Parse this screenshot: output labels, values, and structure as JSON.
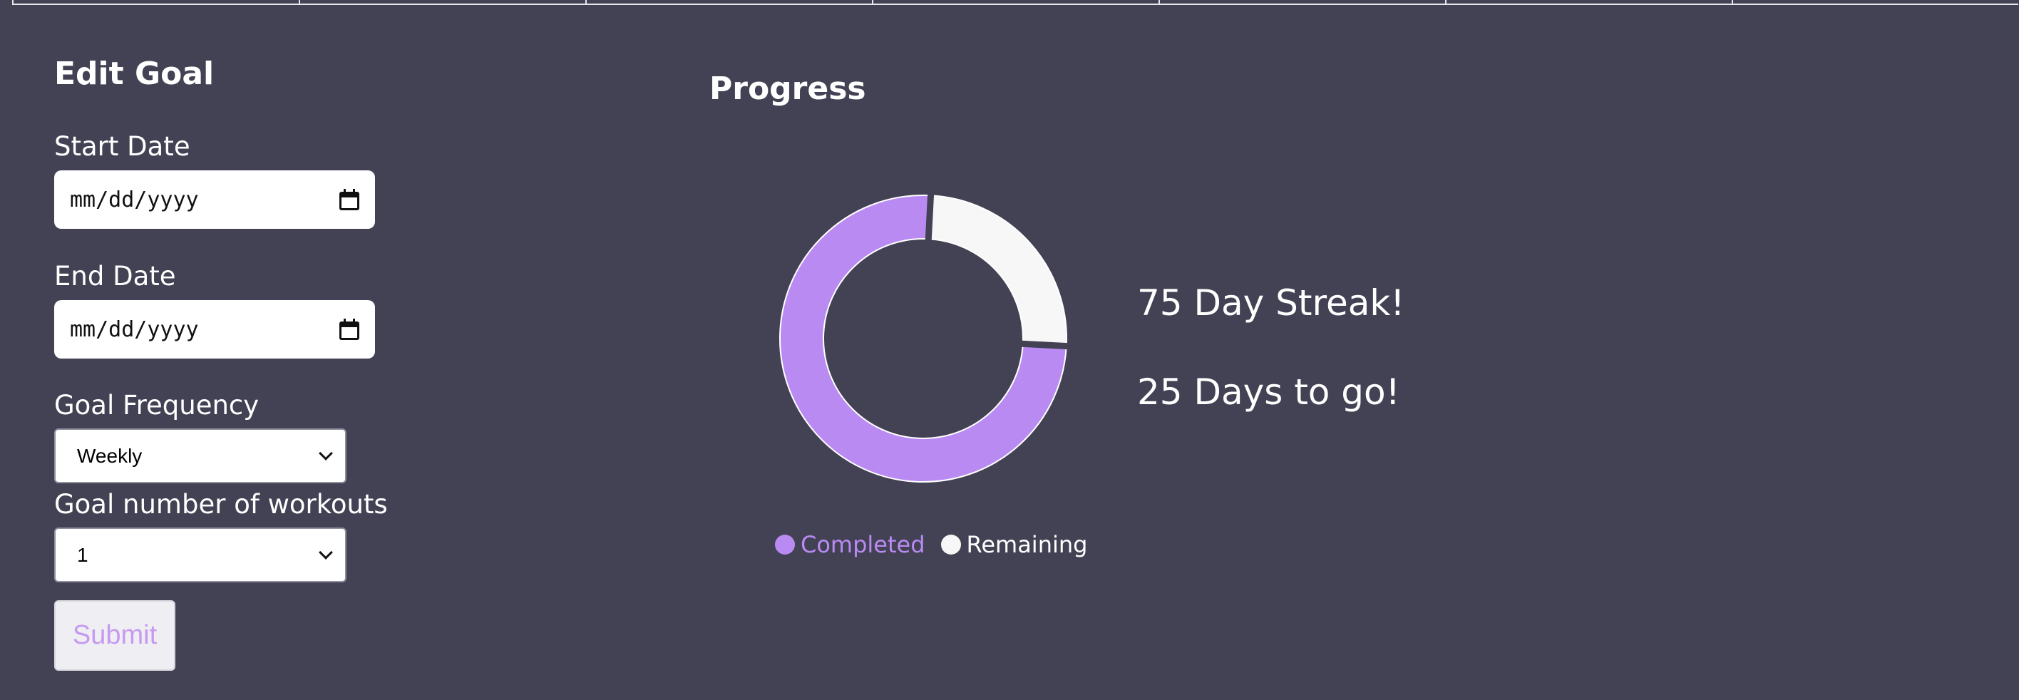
{
  "edit_goal": {
    "title": "Edit Goal",
    "start_date": {
      "label": "Start Date",
      "placeholder": "mm/dd/yyyy"
    },
    "end_date": {
      "label": "End Date",
      "placeholder": "mm/dd/yyyy"
    },
    "frequency": {
      "label": "Goal Frequency",
      "value": "Weekly"
    },
    "workouts": {
      "label": "Goal number of workouts",
      "value": "1"
    },
    "submit_label": "Submit"
  },
  "progress": {
    "title": "Progress",
    "streak_text": "75 Day Streak!",
    "remaining_text": "25 Days to go!"
  },
  "chart_data": {
    "type": "pie",
    "categories": [
      "Completed",
      "Remaining"
    ],
    "values": [
      75,
      25
    ],
    "colors": [
      "#b98af2",
      "#f7f7f7"
    ],
    "legend": "bottom"
  },
  "colors": {
    "background": "#434254",
    "accent": "#b98af2"
  }
}
